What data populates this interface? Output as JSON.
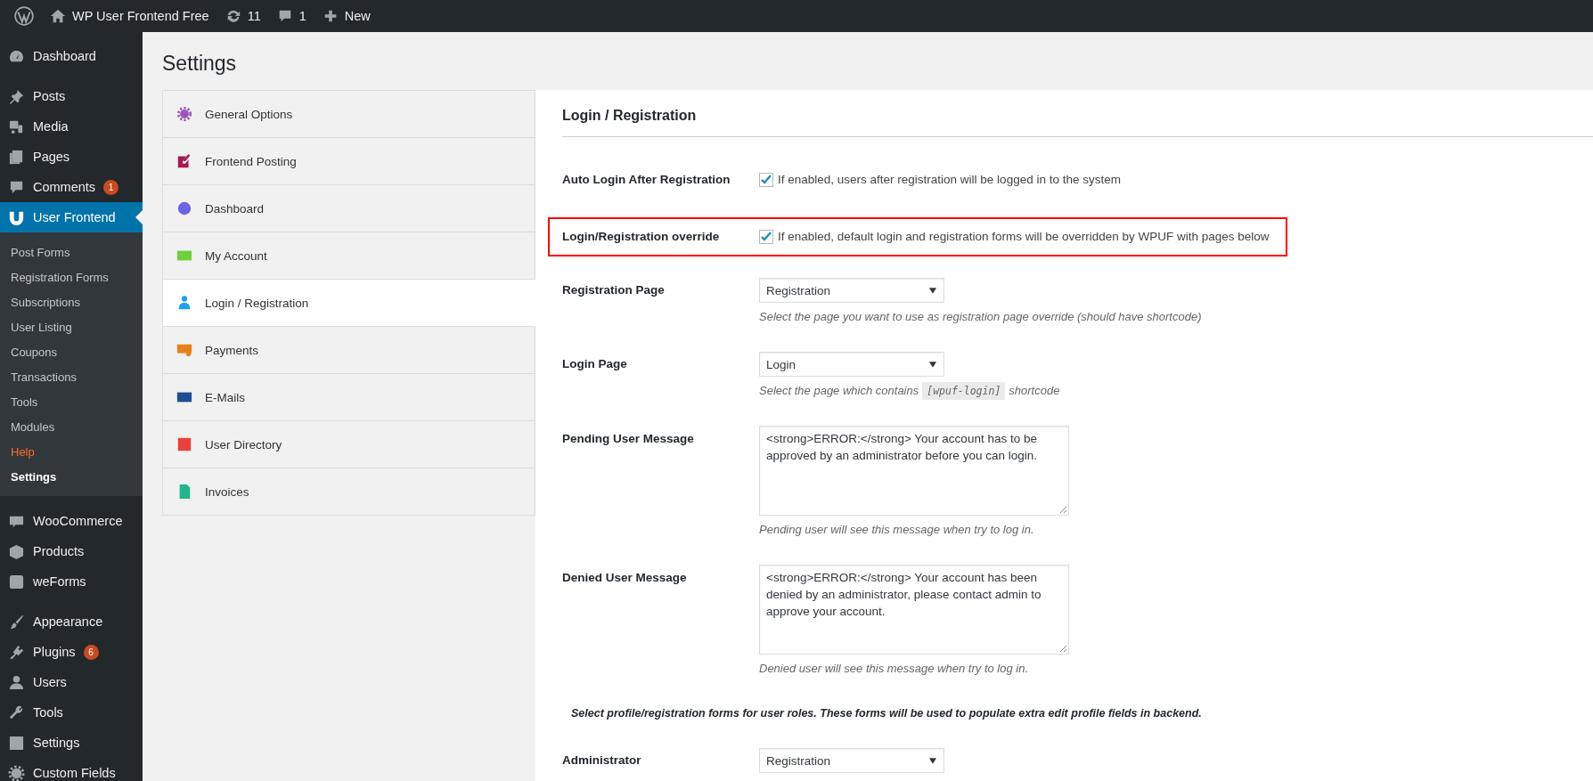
{
  "top_bar": {
    "site_name": "WP User Frontend Free",
    "updates": "11",
    "comments": "1",
    "new_label": "New"
  },
  "sidebar": {
    "groups": [
      {
        "items": [
          {
            "label": "Dashboard",
            "selected": false
          }
        ]
      },
      {
        "items": [
          {
            "label": "Posts",
            "selected": false
          },
          {
            "label": "Media",
            "selected": false
          },
          {
            "label": "Pages",
            "selected": false
          },
          {
            "label": "Comments",
            "selected": false,
            "badge": "1"
          },
          {
            "label": "User Frontend",
            "selected": true,
            "submenu": [
              {
                "label": "Post Forms",
                "selected": false,
                "highlighted": false
              },
              {
                "label": "Registration Forms",
                "selected": false,
                "highlighted": false
              },
              {
                "label": "Subscriptions",
                "selected": false,
                "highlighted": false
              },
              {
                "label": "User Listing",
                "selected": false,
                "highlighted": false
              },
              {
                "label": "Coupons",
                "selected": false,
                "highlighted": false
              },
              {
                "label": "Transactions",
                "selected": false,
                "highlighted": false
              },
              {
                "label": "Tools",
                "selected": false,
                "highlighted": false
              },
              {
                "label": "Modules",
                "selected": false,
                "highlighted": false
              },
              {
                "label": "Help",
                "selected": false,
                "highlighted": true
              },
              {
                "label": "Settings",
                "selected": true,
                "highlighted": false
              }
            ]
          }
        ]
      },
      {
        "items": [
          {
            "label": "WooCommerce",
            "selected": false
          },
          {
            "label": "Products",
            "selected": false
          },
          {
            "label": "weForms",
            "selected": false
          }
        ]
      },
      {
        "items": [
          {
            "label": "Appearance",
            "selected": false
          },
          {
            "label": "Plugins",
            "selected": false,
            "badge": "6"
          },
          {
            "label": "Users",
            "selected": false
          },
          {
            "label": "Tools",
            "selected": false
          },
          {
            "label": "Settings",
            "selected": false
          },
          {
            "label": "Custom Fields",
            "selected": false
          }
        ]
      }
    ]
  },
  "page_title": "Settings",
  "tabs": [
    {
      "label": "General Options",
      "selected": false
    },
    {
      "label": "Frontend Posting",
      "selected": false
    },
    {
      "label": "Dashboard",
      "selected": false
    },
    {
      "label": "My Account",
      "selected": false
    },
    {
      "label": "Login / Registration",
      "selected": true
    },
    {
      "label": "Payments",
      "selected": false
    },
    {
      "label": "E-Mails",
      "selected": false
    },
    {
      "label": "User Directory",
      "selected": false
    },
    {
      "label": "Invoices",
      "selected": false
    }
  ],
  "section_title": "Login / Registration",
  "settings": [
    {
      "kind": "checkbox",
      "label": "Auto Login After Registration",
      "checked": true,
      "text": "If enabled, users after registration will be logged in to the system",
      "highlighted": false
    },
    {
      "kind": "checkbox",
      "label": "Login/Registration override",
      "checked": true,
      "text": "If enabled, default login and registration forms will be overridden by WPUF with pages below",
      "highlighted": true
    },
    {
      "kind": "select",
      "label": "Registration Page",
      "value": "Registration",
      "description": "Select the page you want to use as registration page override (should have shortcode)",
      "highlighted": false
    },
    {
      "kind": "select",
      "label": "Login Page",
      "value": "Login",
      "description": "Select the page which contains",
      "code": "[wpuf-login]",
      "description_after": "shortcode",
      "highlighted": false
    },
    {
      "kind": "textarea",
      "label": "Pending User Message",
      "value": "<strong>ERROR:</strong> Your account has to be approved by an administrator before you can login.",
      "description": "Pending user will see this message when try to log in.",
      "highlighted": false
    },
    {
      "kind": "textarea",
      "label": "Denied User Message",
      "value": "<strong>ERROR:</strong> Your account has been denied by an administrator, please contact admin to approve your account.",
      "description": "Denied user will see this message when try to log in.",
      "highlighted": false
    },
    {
      "kind": "note",
      "text": "Select profile/registration forms for user roles. These forms will be used to populate extra edit profile fields in backend.",
      "highlighted": false
    },
    {
      "kind": "select",
      "label": "Administrator",
      "value": "Registration",
      "highlighted": false
    }
  ]
}
